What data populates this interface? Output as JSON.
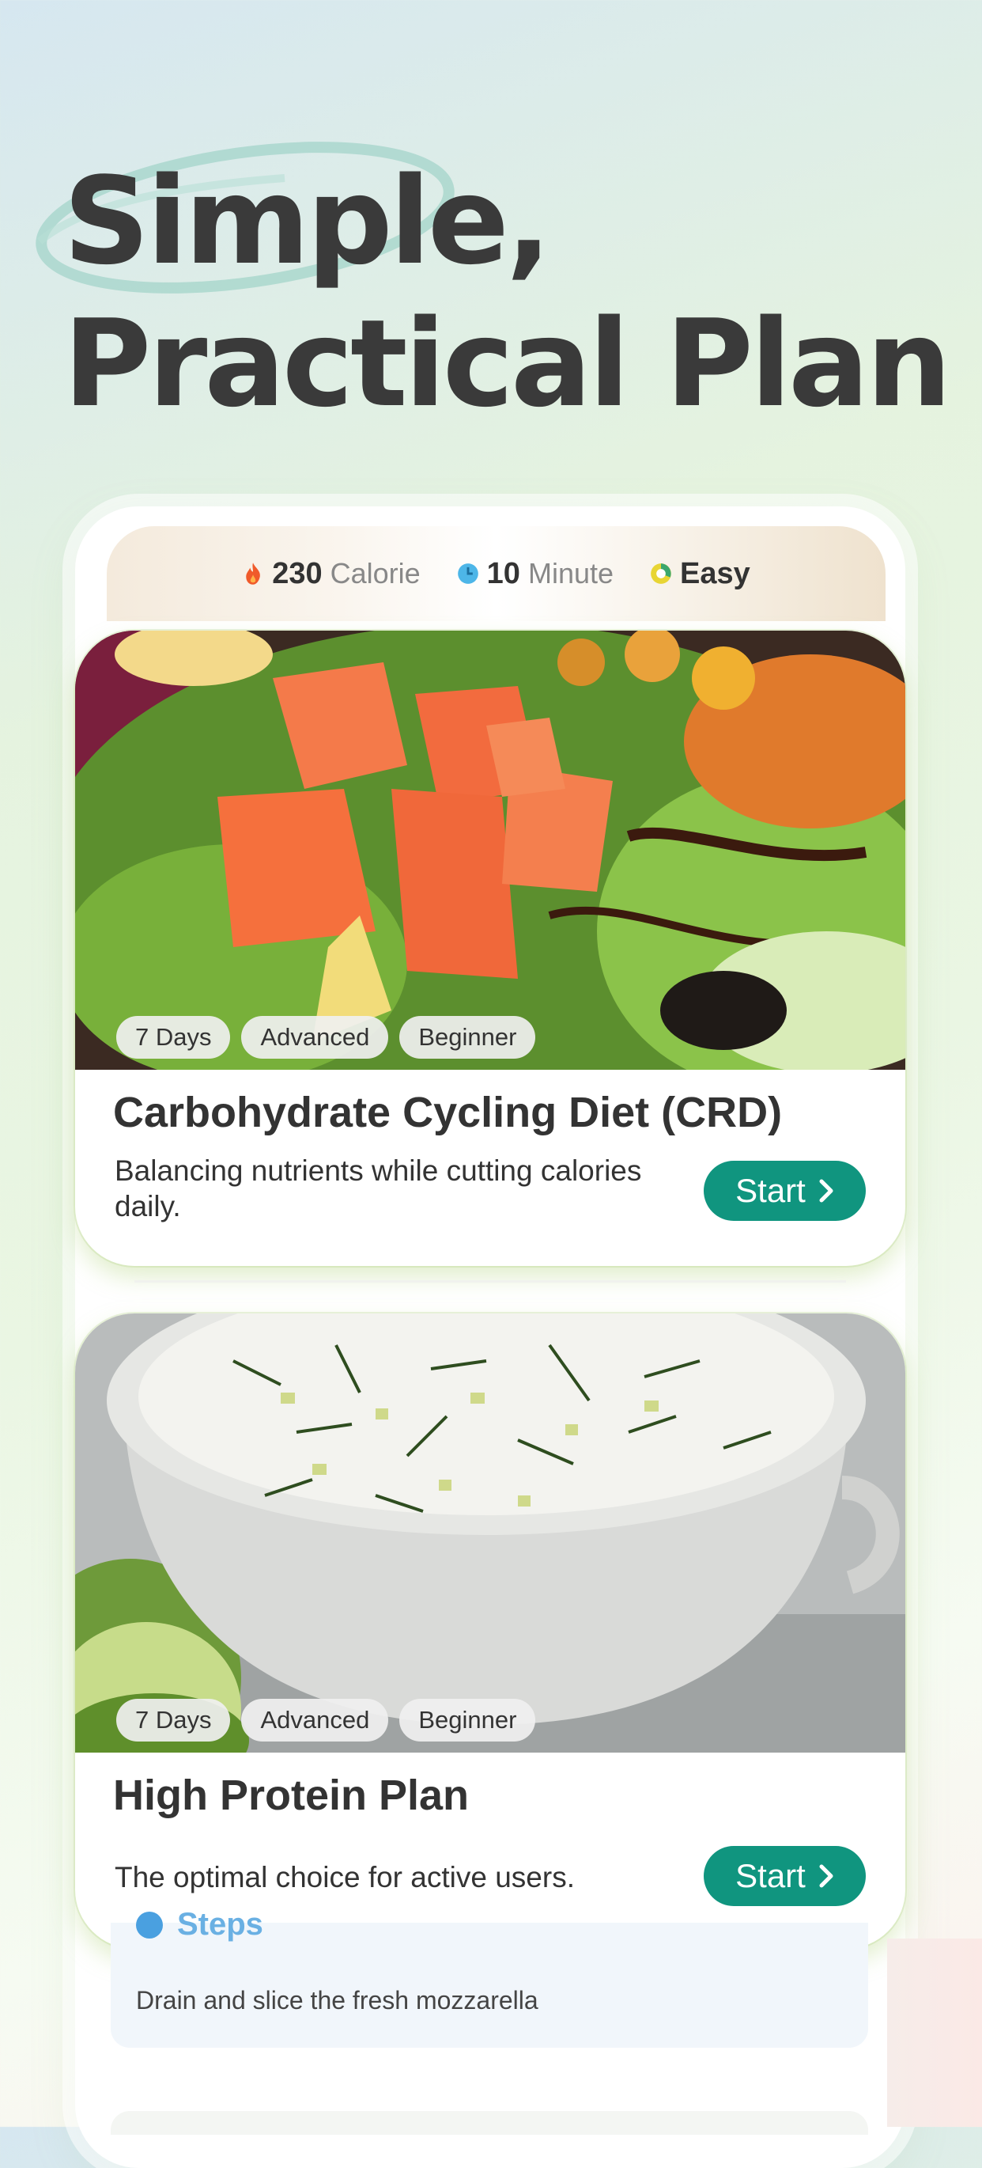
{
  "hero": {
    "title_line1": "Simple,",
    "title_line2": "Practical Plan"
  },
  "stats": {
    "calorie_value": "230",
    "calorie_label": "Calorie",
    "minute_value": "10",
    "minute_label": "Minute",
    "difficulty": "Easy"
  },
  "cards": [
    {
      "tags": [
        "7 Days",
        "Advanced",
        "Beginner"
      ],
      "title": "Carbohydrate Cycling Diet (CRD)",
      "description": "Balancing nutrients while cutting calories daily.",
      "button": "Start"
    },
    {
      "tags": [
        "7 Days",
        "Advanced",
        "Beginner"
      ],
      "title": "High Protein Plan",
      "description": "The optimal choice for active users.",
      "button": "Start"
    }
  ],
  "steps": {
    "heading": "Steps",
    "text": "Drain and slice the fresh mozzarella"
  },
  "colors": {
    "accent": "#10957f",
    "title_text": "#3a3a3a",
    "steps_blue": "#4aa0e0"
  },
  "icons": {
    "calorie": "flame-icon",
    "minute": "clock-icon",
    "difficulty": "gauge-icon",
    "button": "chevron-right-icon"
  }
}
